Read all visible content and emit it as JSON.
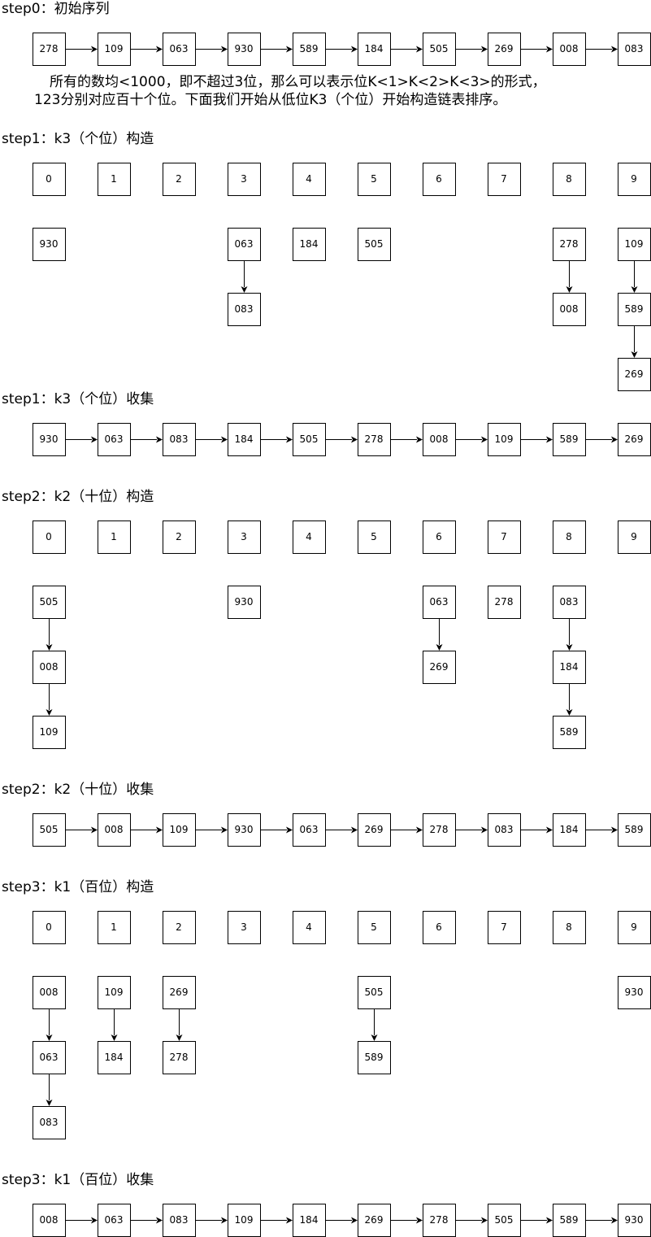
{
  "bucket_labels": [
    "0",
    "1",
    "2",
    "3",
    "4",
    "5",
    "6",
    "7",
    "8",
    "9"
  ],
  "sections": [
    {
      "key": "step0",
      "title": "step0：初始序列",
      "kind": "sequence",
      "values": [
        "278",
        "109",
        "063",
        "930",
        "589",
        "184",
        "505",
        "269",
        "008",
        "083"
      ]
    },
    {
      "key": "step1_build",
      "title": "step1：k3（个位）构造",
      "kind": "buckets",
      "buckets": [
        [
          "930"
        ],
        [],
        [],
        [
          "063",
          "083"
        ],
        [
          "184"
        ],
        [
          "505"
        ],
        [],
        [],
        [
          "278",
          "008"
        ],
        [
          "109",
          "589",
          "269"
        ]
      ]
    },
    {
      "key": "step1_collect",
      "title": "step1：k3（个位）收集",
      "kind": "sequence",
      "values": [
        "930",
        "063",
        "083",
        "184",
        "505",
        "278",
        "008",
        "109",
        "589",
        "269"
      ]
    },
    {
      "key": "step2_build",
      "title": "step2：k2（十位）构造",
      "kind": "buckets",
      "buckets": [
        [
          "505",
          "008",
          "109"
        ],
        [],
        [],
        [
          "930"
        ],
        [],
        [],
        [
          "063",
          "269"
        ],
        [
          "278"
        ],
        [
          "083",
          "184",
          "589"
        ],
        []
      ]
    },
    {
      "key": "step2_collect",
      "title": "step2：k2（十位）收集",
      "kind": "sequence",
      "values": [
        "505",
        "008",
        "109",
        "930",
        "063",
        "269",
        "278",
        "083",
        "184",
        "589"
      ]
    },
    {
      "key": "step3_build",
      "title": "step3：k1（百位）构造",
      "kind": "buckets",
      "buckets": [
        [
          "008",
          "063",
          "083"
        ],
        [
          "109",
          "184"
        ],
        [
          "269",
          "278"
        ],
        [],
        [],
        [
          "505",
          "589"
        ],
        [],
        [],
        [],
        [
          "930"
        ]
      ]
    },
    {
      "key": "step3_collect",
      "title": "step3：k1（百位）收集",
      "kind": "sequence",
      "values": [
        "008",
        "063",
        "083",
        "109",
        "184",
        "269",
        "278",
        "505",
        "589",
        "930"
      ]
    }
  ],
  "explanation": {
    "line1": "所有的数均<1000，即不超过3位，那么可以表示位K<1>K<2>K<3>的形式，",
    "line2": "123分别对应百十个位。下面我们开始从低位K3（个位）开始构造链表排序。"
  }
}
